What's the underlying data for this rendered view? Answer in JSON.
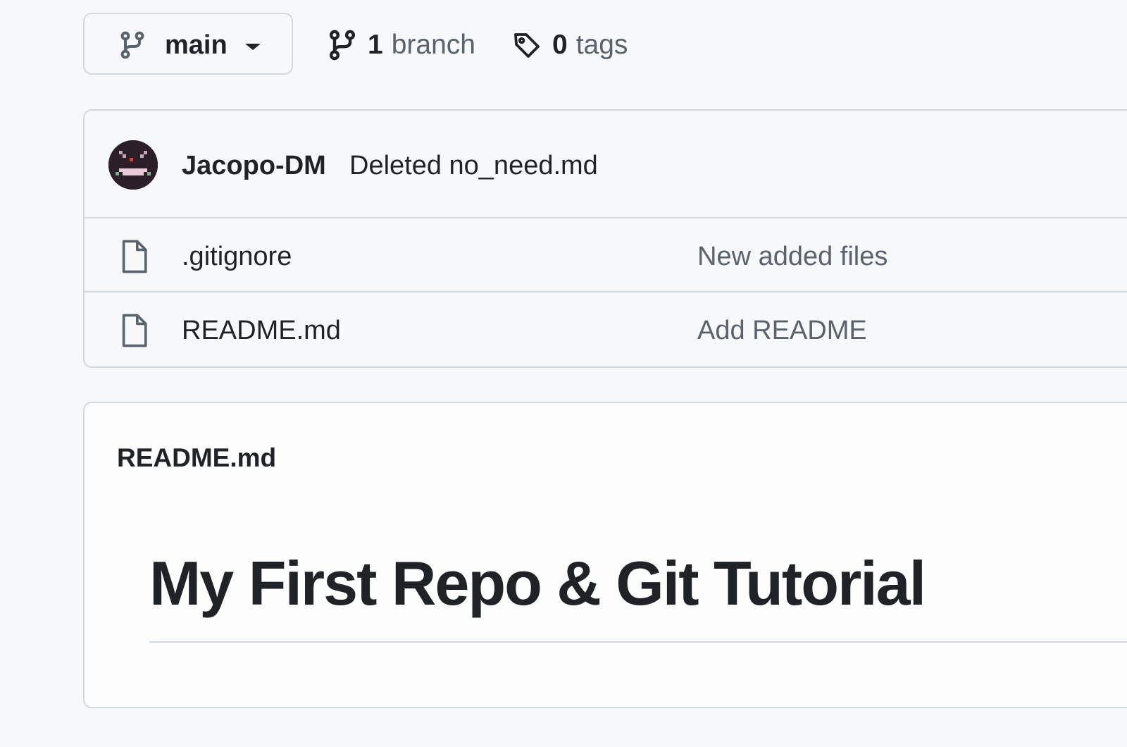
{
  "branch_selector": {
    "current": "main"
  },
  "meta": {
    "branches_count": "1",
    "branches_label": "branch",
    "tags_count": "0",
    "tags_label": "tags"
  },
  "latest_commit": {
    "author": "Jacopo-DM",
    "message": "Deleted no_need.md"
  },
  "files": [
    {
      "name": ".gitignore",
      "commit_message": "New added files",
      "icon": "file-icon"
    },
    {
      "name": "README.md",
      "commit_message": "Add README",
      "icon": "file-icon"
    }
  ],
  "readme": {
    "title": "README.md",
    "heading": "My First Repo & Git Tutorial"
  },
  "colors": {
    "text": "#1f2328",
    "muted": "#59636e",
    "border": "#d1d9e0",
    "background": "#f6f8fa"
  }
}
